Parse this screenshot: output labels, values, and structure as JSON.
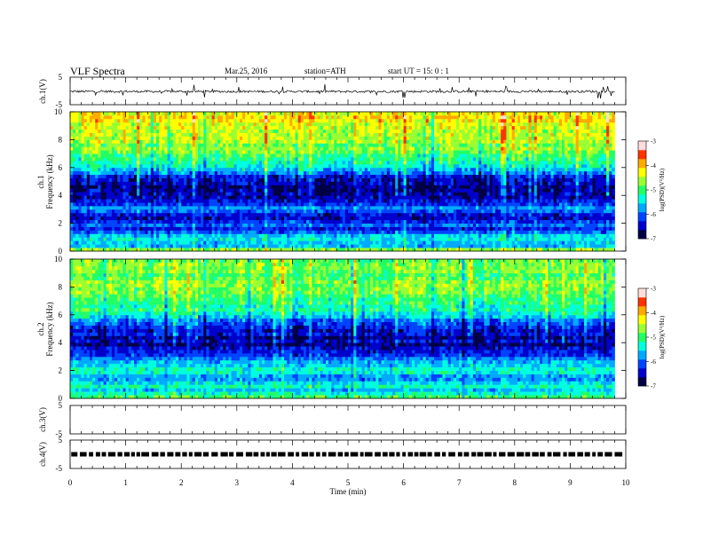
{
  "header": {
    "title": "VLF  Spectra",
    "date": "Mar.25, 2016",
    "station": "station=ATH",
    "start": "start  UT  =    15: 0  : 1"
  },
  "colors": {
    "colorbar": [
      "#000044",
      "#0000cc",
      "#0044ff",
      "#00aaff",
      "#00ffdd",
      "#22ff66",
      "#99ff33",
      "#ffff00",
      "#ffaa00",
      "#ff3300",
      "#ffdddd"
    ],
    "trace": "#000000"
  },
  "chart_data": [
    {
      "type": "line",
      "panel": "ch1-waveform",
      "ylabel": "ch.1(V)",
      "ylim": [
        -5,
        5
      ],
      "yticks": [
        "5",
        "-5"
      ],
      "xlim": [
        0,
        10
      ],
      "x_data_end": 9.8,
      "baseline": -0.2,
      "noise_amplitude": 0.4,
      "spike_amplitude": 2.5
    },
    {
      "type": "heatmap",
      "panel": "ch1-spectrogram",
      "ylabel": "ch.1\nFrequency  (kHz)",
      "ylim": [
        0,
        10
      ],
      "yticks": [
        "0",
        "2",
        "4",
        "6",
        "8",
        "10"
      ],
      "xlim": [
        0,
        10
      ],
      "x_data_end": 9.8,
      "colorbar_label": "log(PSD)(V²/Hz)",
      "colorbar_ticks": [
        "-3",
        "-4",
        "-5",
        "-6",
        "-7"
      ],
      "clim": [
        -7,
        -3
      ],
      "log_psd_profile": [
        {
          "f": 0.0,
          "v": -4.3
        },
        {
          "f": 0.4,
          "v": -5.8
        },
        {
          "f": 1.0,
          "v": -5.4
        },
        {
          "f": 1.6,
          "v": -6.2
        },
        {
          "f": 2.0,
          "v": -6.0
        },
        {
          "f": 2.5,
          "v": -6.6
        },
        {
          "f": 3.0,
          "v": -5.7
        },
        {
          "f": 3.5,
          "v": -6.3
        },
        {
          "f": 4.5,
          "v": -6.7
        },
        {
          "f": 5.5,
          "v": -6.1
        },
        {
          "f": 6.0,
          "v": -5.4
        },
        {
          "f": 7.0,
          "v": -4.9
        },
        {
          "f": 8.0,
          "v": -4.5
        },
        {
          "f": 9.0,
          "v": -4.3
        },
        {
          "f": 10.0,
          "v": -4.2
        }
      ]
    },
    {
      "type": "heatmap",
      "panel": "ch2-spectrogram",
      "ylabel": "ch.2\nFrequency  (kHz)",
      "ylim": [
        0,
        10
      ],
      "yticks": [
        "0",
        "2",
        "4",
        "6",
        "8",
        "10"
      ],
      "xlim": [
        0,
        10
      ],
      "x_data_end": 9.8,
      "colorbar_label": "log(PSD)(V²/Hz)",
      "colorbar_ticks": [
        "-3",
        "-4",
        "-5",
        "-6",
        "-7"
      ],
      "clim": [
        -7,
        -3
      ],
      "log_psd_profile": [
        {
          "f": 0.0,
          "v": -4.6
        },
        {
          "f": 0.5,
          "v": -5.7
        },
        {
          "f": 1.0,
          "v": -5.2
        },
        {
          "f": 1.5,
          "v": -5.9
        },
        {
          "f": 2.0,
          "v": -5.3
        },
        {
          "f": 2.6,
          "v": -5.6
        },
        {
          "f": 3.2,
          "v": -6.3
        },
        {
          "f": 4.0,
          "v": -6.6
        },
        {
          "f": 4.8,
          "v": -6.4
        },
        {
          "f": 5.5,
          "v": -6.0
        },
        {
          "f": 6.2,
          "v": -5.3
        },
        {
          "f": 7.0,
          "v": -5.0
        },
        {
          "f": 8.0,
          "v": -4.8
        },
        {
          "f": 9.0,
          "v": -4.8
        },
        {
          "f": 10.0,
          "v": -4.7
        }
      ]
    },
    {
      "type": "line",
      "panel": "ch3-waveform",
      "ylabel": "ch.3(V)",
      "ylim": [
        -5,
        5
      ],
      "yticks": [
        "5",
        "-5"
      ],
      "xlim": [
        0,
        10
      ],
      "flat": true
    },
    {
      "type": "line",
      "panel": "ch4-waveform",
      "ylabel": "ch.4(V)",
      "ylim": [
        -5,
        5
      ],
      "yticks": [
        "5",
        "-5"
      ],
      "xlim": [
        0,
        10
      ],
      "x_data_end": 9.8,
      "baseline": 0,
      "dashed_band": true
    }
  ],
  "xaxis": {
    "label": "Time  (min)",
    "ticks": [
      "0",
      "1",
      "2",
      "3",
      "4",
      "5",
      "6",
      "7",
      "8",
      "9",
      "10"
    ]
  }
}
